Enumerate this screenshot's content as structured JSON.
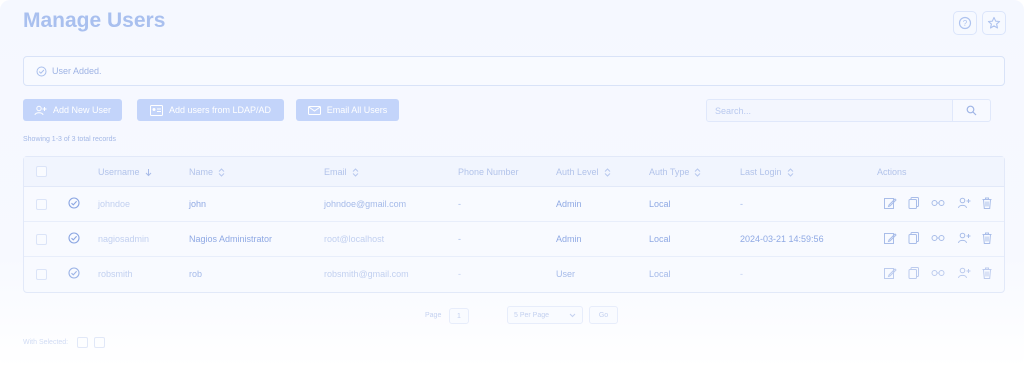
{
  "page": {
    "title": "Manage Users"
  },
  "top_icons": [
    "help-icon",
    "star-icon"
  ],
  "alert": {
    "message": "User Added."
  },
  "toolbar": {
    "add_new_user": "Add New User",
    "add_ldap": "Add users from LDAP/AD",
    "email_all": "Email All Users"
  },
  "search": {
    "placeholder": "Search..."
  },
  "records": "Showing 1-3 of 3 total records",
  "table": {
    "headers": {
      "username": "Username",
      "name": "Name",
      "email": "Email",
      "phone": "Phone Number",
      "auth_level": "Auth Level",
      "auth_type": "Auth Type",
      "last_login": "Last Login",
      "actions": "Actions"
    },
    "rows": [
      {
        "username": "johndoe",
        "name": "john",
        "email": "johndoe@gmail.com",
        "phone": "-",
        "auth_level": "Admin",
        "auth_type": "Local",
        "last_login": "-"
      },
      {
        "username": "nagiosadmin",
        "name": "Nagios Administrator",
        "email": "root@localhost",
        "phone": "-",
        "auth_level": "Admin",
        "auth_type": "Local",
        "last_login": "2024-03-21 14:59:56"
      },
      {
        "username": "robsmith",
        "name": "rob",
        "email": "robsmith@gmail.com",
        "phone": "-",
        "auth_level": "User",
        "auth_type": "Local",
        "last_login": "-"
      }
    ]
  },
  "pagination": {
    "page_label": "Page",
    "page_value": "1",
    "per_page": "5 Per Page",
    "go": "Go"
  },
  "footer": {
    "with_selected": "With Selected:"
  },
  "colors": {
    "accent": "#c3d4fa",
    "title": "#a9c0ef"
  }
}
